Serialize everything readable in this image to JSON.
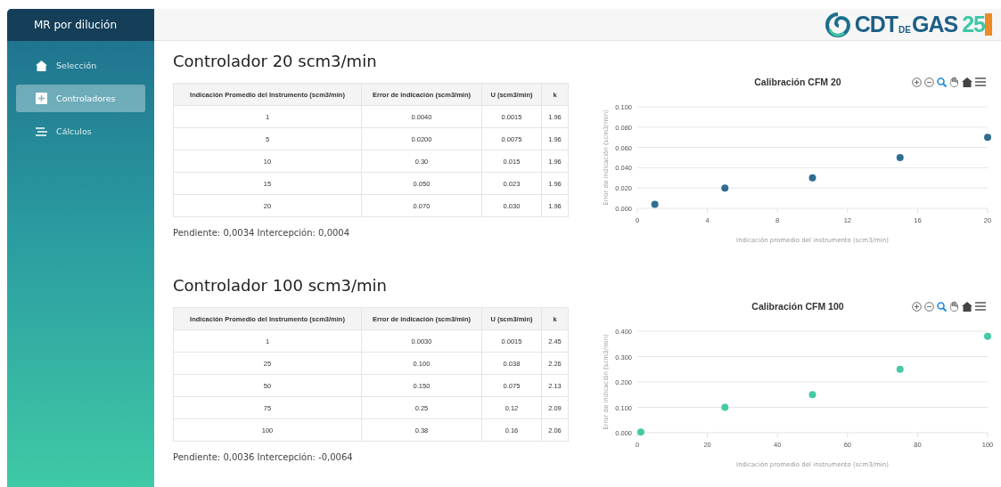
{
  "sidebar": {
    "title": "MR por dilución",
    "items": [
      {
        "label": "Selección",
        "kind": "home",
        "selected": false
      },
      {
        "label": "Controladores",
        "kind": "plus",
        "selected": true
      },
      {
        "label": "Cálculos",
        "kind": "lines",
        "selected": false
      }
    ]
  },
  "logo": {
    "parts": [
      "CDT",
      "DE",
      "GAS",
      "25"
    ]
  },
  "sections": [
    {
      "title": "Controlador 20 scm3/min",
      "table": {
        "columns": [
          "Indicación Promedio del Instrumento (scm3/min)",
          "Error de indicación (scm3/min)",
          "U (scm3/min)",
          "k"
        ],
        "rows": [
          [
            "1",
            "0.0040",
            "0.0015",
            "1.96"
          ],
          [
            "5",
            "0.0200",
            "0.0075",
            "1.96"
          ],
          [
            "10",
            "0.30",
            "0.015",
            "1.96"
          ],
          [
            "15",
            "0.050",
            "0.023",
            "1.96"
          ],
          [
            "20",
            "0.070",
            "0.030",
            "1.96"
          ]
        ]
      },
      "summary": "Pendiente: 0,0034 Intercepción: 0,0004",
      "chart_data": {
        "type": "scatter",
        "title": "Calibración CFM 20",
        "xlabel": "Indicación promedio del instrumento (scm3/min)",
        "ylabel": "Error de indicación (scm3/min)",
        "x": [
          1,
          5,
          10,
          15,
          20
        ],
        "series": [
          {
            "color": "#2e6e91",
            "values": [
              0.004,
              0.02,
              0.03,
              0.05,
              0.07
            ]
          }
        ],
        "grid": true,
        "xlim": [
          0,
          20
        ],
        "ylim": [
          0,
          0.1
        ],
        "xticks": [
          0,
          4,
          8,
          12,
          16,
          20
        ],
        "yticks": [
          {
            "value": 0,
            "label": "0.000"
          },
          {
            "value": 0.02,
            "label": "0.020"
          },
          {
            "value": 0.04,
            "label": "0.040"
          },
          {
            "value": 0.06,
            "label": "0.060"
          },
          {
            "value": 0.08,
            "label": "0.080"
          },
          {
            "value": 0.1,
            "label": "0.100"
          }
        ]
      }
    },
    {
      "title": "Controlador 100 scm3/min",
      "table": {
        "columns": [
          "Indicación Promedio del Instrumento (scm3/min)",
          "Error de indicación (scm3/min)",
          "U (scm3/min)",
          "k"
        ],
        "rows": [
          [
            "1",
            "0.0030",
            "0.0015",
            "2.45"
          ],
          [
            "25",
            "0.100",
            "0.038",
            "2.26"
          ],
          [
            "50",
            "0.150",
            "0.075",
            "2.13"
          ],
          [
            "75",
            "0.25",
            "0.12",
            "2.09"
          ],
          [
            "100",
            "0.38",
            "0.16",
            "2.06"
          ]
        ]
      },
      "summary": "Pendiente: 0,0036 Intercepción: -0,0064",
      "chart_data": {
        "type": "scatter",
        "title": "Calibración CFM 100",
        "xlabel": "Indicación promedio del instrumento (scm3/min)",
        "ylabel": "Error de indicación (scm3/min)",
        "x": [
          1,
          25,
          50,
          75,
          100
        ],
        "series": [
          {
            "color": "#45c9a5",
            "values": [
              0.003,
              0.1,
              0.15,
              0.25,
              0.38
            ]
          }
        ],
        "grid": true,
        "xlim": [
          0,
          100
        ],
        "ylim": [
          0,
          0.4
        ],
        "xticks": [
          0,
          20,
          40,
          60,
          80,
          100
        ],
        "yticks": [
          {
            "value": 0,
            "label": "0.000"
          },
          {
            "value": 0.1,
            "label": "0.100"
          },
          {
            "value": 0.2,
            "label": "0.200"
          },
          {
            "value": 0.3,
            "label": "0.300"
          },
          {
            "value": 0.4,
            "label": "0.400"
          }
        ]
      }
    }
  ]
}
